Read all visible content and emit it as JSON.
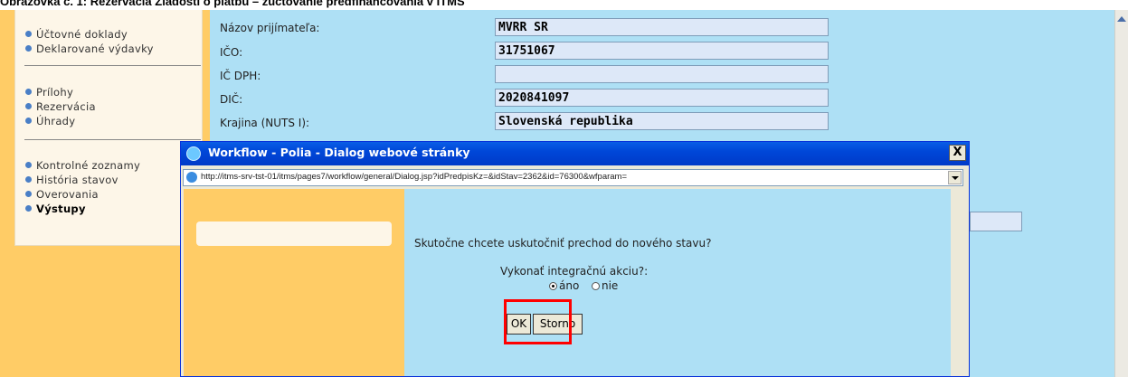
{
  "caption": "Obrazovka č. 1:  Rezervácia Žiadosti o platbu – zúčtovanie predfinancovania v ITMS",
  "sidebar": {
    "group1": [
      "Účtovné doklady",
      "Deklarované výdavky"
    ],
    "group2": [
      "Prílohy",
      "Rezervácia",
      "Úhrady"
    ],
    "group3": [
      "Kontrolné zoznamy",
      "História stavov",
      "Overovania",
      "Výstupy"
    ]
  },
  "form": {
    "rows": [
      {
        "label": "Názov prijímateľa:",
        "value": "MVRR SR"
      },
      {
        "label": "IČO:",
        "value": "31751067"
      },
      {
        "label": "IČ DPH:",
        "value": ""
      },
      {
        "label": "DIČ:",
        "value": "2020841097"
      },
      {
        "label": "Krajina (NUTS I):",
        "value": "Slovenská republika"
      }
    ]
  },
  "dialog": {
    "title": "Workflow - Polia - Dialog webové stránky",
    "close_label": "X",
    "url": "http://itms-srv-tst-01/itms/pages7/workflow/general/Dialog.jsp?idPredpisKz=&idStav=2362&id=76300&wfparam=",
    "question": "Skutočne chcete uskutočniť prechod do nového stavu?",
    "integration_label": "Vykonať integračnú akciu?:",
    "radio_yes": "áno",
    "radio_no": "nie",
    "selected": "áno",
    "ok_label": "OK",
    "cancel_label": "Storno"
  },
  "colors": {
    "accent_orange": "#ffcc66",
    "content_blue": "#aee0f5",
    "highlight": "#ff0000",
    "titlebar": "#0047d8"
  }
}
